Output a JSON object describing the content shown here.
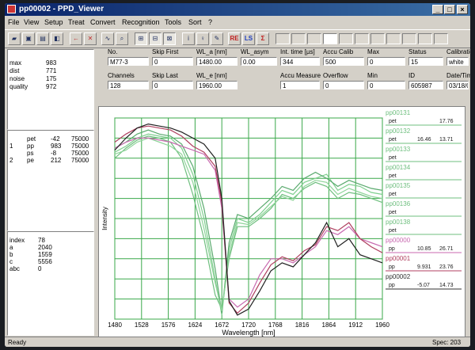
{
  "window": {
    "title": "pp00002 - PPD_Viewer"
  },
  "menu": [
    "File",
    "View",
    "Setup",
    "Treat",
    "Convert",
    "Recognition",
    "Tools",
    "Sort",
    "?"
  ],
  "toolbar": {
    "buttons": [
      "open",
      "save",
      "print",
      "book",
      "back",
      "delete",
      "graph",
      "zoom",
      "fit",
      "fit-x",
      "fit-y",
      "info",
      "light",
      "bulb",
      "REC",
      "LS",
      "sigma"
    ]
  },
  "stats": [
    {
      "label": "max",
      "value": "983"
    },
    {
      "label": "dist",
      "value": "771"
    },
    {
      "label": "noise",
      "value": "175"
    },
    {
      "label": "quality",
      "value": "972"
    }
  ],
  "peaks": [
    {
      "idx": "",
      "name": "pet",
      "val": "-42",
      "n": "75000"
    },
    {
      "idx": "1",
      "name": "pp",
      "val": "983",
      "n": "75000"
    },
    {
      "idx": "",
      "name": "ps",
      "val": "-8",
      "n": "75000"
    },
    {
      "idx": "2",
      "name": "pe",
      "val": "212",
      "n": "75000"
    }
  ],
  "index": [
    {
      "label": "index",
      "value": "78"
    },
    {
      "label": "a",
      "value": "2040"
    },
    {
      "label": "b",
      "value": "1559"
    },
    {
      "label": "c",
      "value": "5556"
    },
    {
      "label": "abc",
      "value": "0"
    }
  ],
  "fields": {
    "no": {
      "label": "No.",
      "value": "M77-3"
    },
    "skip_first": {
      "label": "Skip First",
      "value": "0"
    },
    "wl_a": {
      "label": "WL_a [nm]",
      "value": "1480.00"
    },
    "wl_asym": {
      "label": "WL_asym",
      "value": "0.00"
    },
    "int_time": {
      "label": "Int. time [µs]",
      "value": "344"
    },
    "accu_calib": {
      "label": "Accu Calib",
      "value": "500"
    },
    "max": {
      "label": "Max",
      "value": "0"
    },
    "status": {
      "label": "Status",
      "value": "15"
    },
    "calibration": {
      "label": "Calibration",
      "value": "white"
    },
    "channels": {
      "label": "Channels",
      "value": "128"
    },
    "skip_last": {
      "label": "Skip Last",
      "value": "0"
    },
    "wl_e": {
      "label": "WL_e [nm]",
      "value": "1960.00"
    },
    "accu_measure": {
      "label": "Accu Measure",
      "value": "1"
    },
    "overflow": {
      "label": "Overflow",
      "value": "0"
    },
    "min": {
      "label": "Min",
      "value": "0"
    },
    "id": {
      "label": "ID",
      "value": "605987"
    },
    "date_time": {
      "label": "Date/Time",
      "value": "03/18/0"
    }
  },
  "legend": [
    {
      "name": "pp00131",
      "sub": "pet",
      "v1": "",
      "v2": "17.76",
      "color": "#6fbf7f"
    },
    {
      "name": "pp00132",
      "sub": "pet",
      "v1": "16.46",
      "v2": "13.71",
      "color": "#6fbf7f"
    },
    {
      "name": "pp00133",
      "sub": "pet",
      "v1": "",
      "v2": "",
      "color": "#6fbf7f"
    },
    {
      "name": "pp00134",
      "sub": "pet",
      "v1": "",
      "v2": "",
      "color": "#6fbf7f"
    },
    {
      "name": "pp00135",
      "sub": "pet",
      "v1": "",
      "v2": "",
      "color": "#6fbf7f"
    },
    {
      "name": "pp00136",
      "sub": "pet",
      "v1": "",
      "v2": "",
      "color": "#6fbf7f"
    },
    {
      "name": "pp00138",
      "sub": "pet",
      "v1": "",
      "v2": "",
      "color": "#6fbf7f"
    },
    {
      "name": "pp00000",
      "sub": "pp",
      "v1": "10.85",
      "v2": "26.71",
      "color": "#c86ab0"
    },
    {
      "name": "pp00001",
      "sub": "pp",
      "v1": "9.931",
      "v2": "23.76",
      "color": "#b04060"
    },
    {
      "name": "pp00002",
      "sub": "pp",
      "v1": "-5.07",
      "v2": "14.73",
      "color": "#303030"
    }
  ],
  "status_bar": {
    "left": "Ready",
    "right": "Spec: 203"
  },
  "chart_data": {
    "type": "line",
    "xlabel": "Wavelength [nm]",
    "ylabel": "Intensity",
    "xlim": [
      1480,
      1960
    ],
    "xticks": [
      1480,
      1528,
      1576,
      1624,
      1672,
      1720,
      1768,
      1816,
      1864,
      1912,
      1960
    ],
    "ylim": [
      0,
      100
    ],
    "grid": true,
    "series": [
      {
        "name": "pp00131",
        "color": "#7fcf8f",
        "x": [
          1480,
          1500,
          1520,
          1540,
          1560,
          1580,
          1600,
          1620,
          1640,
          1660,
          1672,
          1685,
          1700,
          1720,
          1740,
          1760,
          1780,
          1800,
          1820,
          1840,
          1860,
          1880,
          1900,
          1920,
          1940,
          1960
        ],
        "y": [
          83,
          86,
          90,
          92,
          91,
          90,
          85,
          72,
          50,
          20,
          2,
          35,
          50,
          48,
          52,
          58,
          64,
          62,
          68,
          70,
          72,
          64,
          67,
          66,
          63,
          62
        ]
      },
      {
        "name": "pp00132",
        "color": "#6fbf7f",
        "x": [
          1480,
          1500,
          1520,
          1540,
          1560,
          1580,
          1600,
          1620,
          1640,
          1660,
          1672,
          1685,
          1700,
          1720,
          1740,
          1760,
          1780,
          1800,
          1820,
          1840,
          1860,
          1880,
          1900,
          1920,
          1940,
          1960
        ],
        "y": [
          80,
          85,
          89,
          91,
          90,
          88,
          80,
          62,
          40,
          12,
          5,
          30,
          46,
          46,
          50,
          55,
          62,
          60,
          65,
          68,
          66,
          60,
          63,
          62,
          60,
          58
        ]
      },
      {
        "name": "pp00133",
        "color": "#5aaa6e",
        "x": [
          1480,
          1500,
          1520,
          1540,
          1560,
          1580,
          1600,
          1620,
          1640,
          1660,
          1672,
          1685,
          1700,
          1720,
          1740,
          1760,
          1780,
          1800,
          1820,
          1840,
          1860,
          1880,
          1900,
          1920,
          1940,
          1960
        ],
        "y": [
          85,
          88,
          92,
          94,
          92,
          91,
          87,
          76,
          55,
          25,
          3,
          38,
          52,
          50,
          55,
          60,
          66,
          64,
          70,
          73,
          70,
          66,
          69,
          67,
          65,
          64
        ]
      },
      {
        "name": "pp00134",
        "color": "#8fd49a",
        "x": [
          1480,
          1500,
          1520,
          1540,
          1560,
          1580,
          1600,
          1620,
          1640,
          1660,
          1672,
          1685,
          1700,
          1720,
          1740,
          1760,
          1780,
          1800,
          1820,
          1840,
          1860,
          1880,
          1900,
          1920,
          1940,
          1960
        ],
        "y": [
          82,
          84,
          88,
          90,
          88,
          86,
          82,
          68,
          45,
          18,
          4,
          32,
          48,
          47,
          51,
          56,
          61,
          59,
          66,
          69,
          68,
          62,
          65,
          63,
          61,
          60
        ]
      },
      {
        "name": "pp00000",
        "color": "#c86ab0",
        "x": [
          1480,
          1500,
          1520,
          1540,
          1560,
          1580,
          1600,
          1620,
          1640,
          1660,
          1672,
          1685,
          1700,
          1720,
          1740,
          1760,
          1780,
          1800,
          1820,
          1840,
          1860,
          1880,
          1900,
          1920,
          1940,
          1960
        ],
        "y": [
          85,
          88,
          90,
          90,
          89,
          88,
          86,
          84,
          82,
          74,
          55,
          10,
          6,
          10,
          22,
          30,
          30,
          28,
          32,
          36,
          44,
          42,
          46,
          40,
          38,
          36
        ]
      },
      {
        "name": "pp00001",
        "color": "#b04060",
        "x": [
          1480,
          1500,
          1520,
          1540,
          1560,
          1580,
          1600,
          1620,
          1640,
          1660,
          1672,
          1685,
          1700,
          1720,
          1740,
          1760,
          1780,
          1800,
          1820,
          1840,
          1860,
          1880,
          1900,
          1920,
          1940,
          1960
        ],
        "y": [
          88,
          92,
          95,
          96,
          95,
          94,
          91,
          86,
          83,
          76,
          58,
          8,
          3,
          8,
          18,
          27,
          31,
          29,
          34,
          37,
          46,
          44,
          48,
          40,
          36,
          33
        ]
      },
      {
        "name": "pp00002",
        "color": "#202020",
        "x": [
          1480,
          1500,
          1520,
          1540,
          1560,
          1580,
          1600,
          1620,
          1640,
          1660,
          1672,
          1685,
          1700,
          1720,
          1740,
          1760,
          1780,
          1800,
          1820,
          1840,
          1860,
          1880,
          1900,
          1920,
          1940,
          1960
        ],
        "y": [
          84,
          90,
          95,
          97,
          96,
          95,
          93,
          90,
          87,
          80,
          60,
          9,
          2,
          5,
          14,
          24,
          28,
          26,
          32,
          38,
          48,
          36,
          40,
          32,
          30,
          28
        ]
      }
    ]
  }
}
